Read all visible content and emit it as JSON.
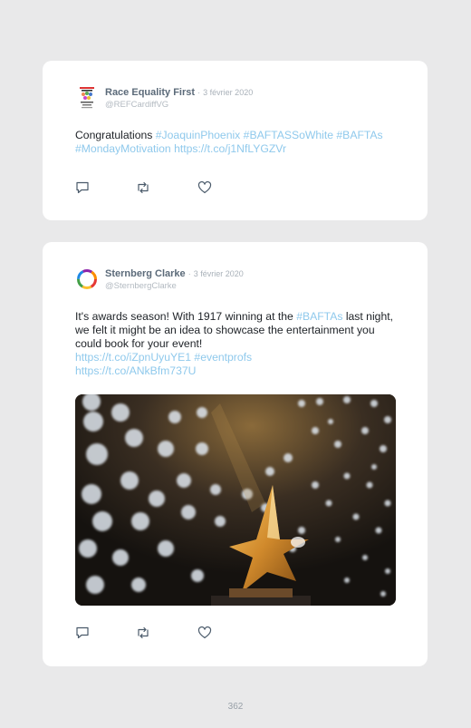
{
  "tweets": [
    {
      "name": "Race Equality First",
      "date": "3 février 2020",
      "handle": "@REFCardiffVG",
      "text": {
        "intro": "Congratulations ",
        "tag1": "#JoaquinPhoenix",
        "tag2": "#BAFTASSoWhite",
        "tag3": "#BAFTAs",
        "tag4": "#MondayMotivation",
        "url": "https://t.co/j1NfLYGZVr"
      },
      "avatar_icon": "race-equality-first-logo"
    },
    {
      "name": "Sternberg Clarke",
      "date": "3 février 2020",
      "handle": "@SternbergClarke",
      "text": {
        "part1": "It's awards season! With 1917 winning at the ",
        "tag1": "#BAFTAs",
        "part2": " last night, we felt it might be an idea to showcase the entertainment you could book for your event!",
        "url1": "https://t.co/iZpnUyuYE1",
        "tag2": "#eventprofs",
        "url2": "https://t.co/ANkBfm737U"
      },
      "avatar_icon": "sternberg-clarke-ring-logo",
      "image_alt": "Golden star award trophy with bokeh lights"
    }
  ],
  "separator": "·",
  "page_number": "362",
  "icons": {
    "reply": "reply-icon",
    "retweet": "retweet-icon",
    "like": "heart-icon"
  },
  "colors": {
    "link": "#8fc9ec",
    "name": "#5b6a79",
    "muted": "#a9b1b9",
    "card": "#ffffff",
    "page": "#e9e9ea"
  }
}
